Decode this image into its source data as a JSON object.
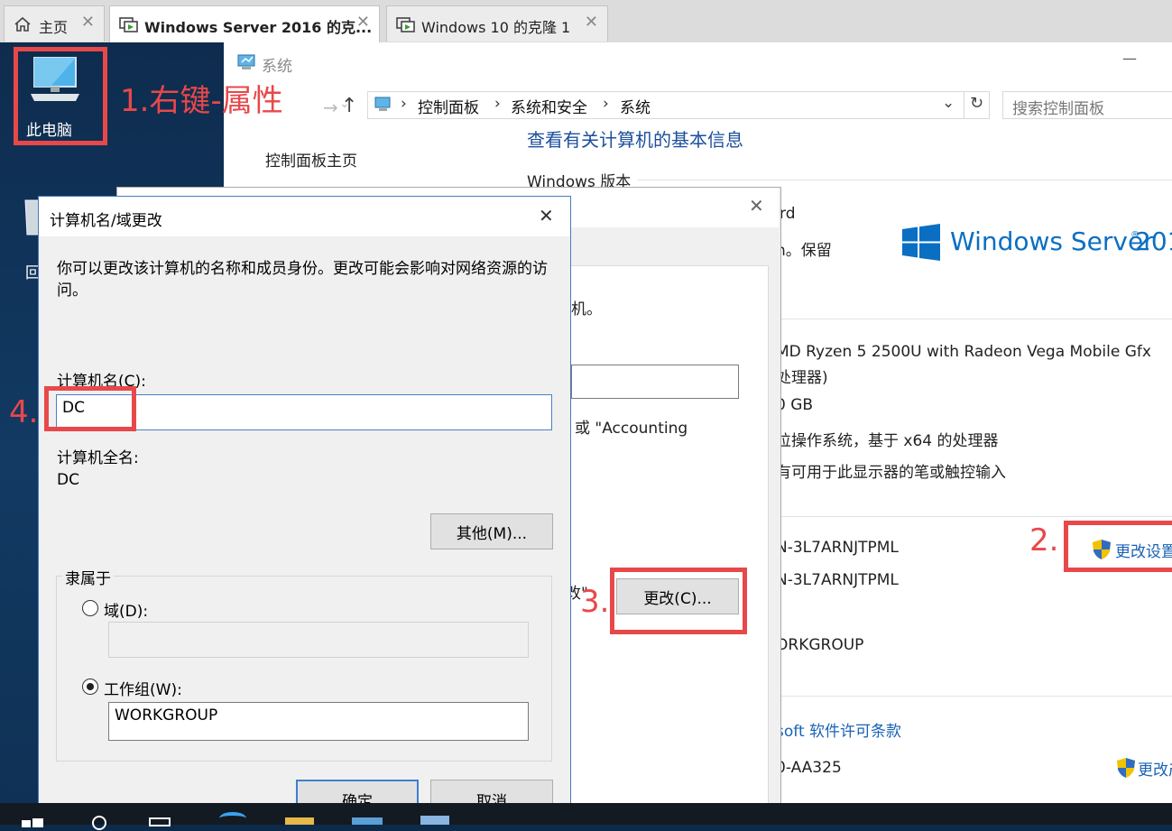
{
  "tabs": [
    {
      "label": "主页",
      "close": "✕"
    },
    {
      "label": "Windows Server 2016 的克...",
      "close": "✕"
    },
    {
      "label": "Windows 10 的克隆 1",
      "close": "✕"
    }
  ],
  "desktop": {
    "this_pc_label": "此电脑",
    "recycle_label": "回"
  },
  "system_window": {
    "title": "系统",
    "minimize": "—",
    "breadcrumb": [
      "控制面板",
      "系统和安全",
      "系统"
    ],
    "search_placeholder": "搜索控制面板",
    "sidebar_home": "控制面板主页",
    "heading": "查看有关计算机的基本信息",
    "windows_version_section": "Windows 版本",
    "edition_fragment": "rd",
    "copyright_fragment": "n。保留",
    "logo_text": "Windows Server",
    "logo_number": "201",
    "processor": "MD Ryzen 5 2500U with Radeon Vega Mobile Gfx",
    "processor_2": "处理器)",
    "memory": "0 GB",
    "system_type": "位操作系统，基于 x64 的处理器",
    "pen_touch": "有可用于此显示器的笔或触控输入",
    "computer_name": "N-3L7ARNJTPML",
    "full_computer_name": "N-3L7ARNJTPML",
    "workgroup": "ORKGROUP",
    "change_settings": "更改设置",
    "license_link": "soft 软件许可条款",
    "product_id": "0-AA325",
    "change_key": "更改产"
  },
  "properties_dialog": {
    "close": "✕",
    "text1": "机。",
    "text2": "或 \"Accounting",
    "text3": "改\"",
    "change_button": "更改(C)..."
  },
  "name_dialog": {
    "title": "计算机名/域更改",
    "close": "✕",
    "description": "你可以更改该计算机的名称和成员身份。更改可能会影响对网络资源的访问。",
    "computer_name_label": "计算机名(C):",
    "computer_name_value": "DC",
    "full_name_label": "计算机全名:",
    "full_name_value": "DC",
    "more_button": "其他(M)...",
    "member_of_label": "隶属于",
    "domain_label": "域(D):",
    "domain_value": "",
    "workgroup_label": "工作组(W):",
    "workgroup_value": "WORKGROUP",
    "ok_button": "确定",
    "cancel_button": "取消"
  },
  "annotations": {
    "step1": "1.右键-属性",
    "step2": "2.",
    "step3": "3.",
    "step4": "4."
  },
  "colors": {
    "annotation_red": "#e8484a",
    "link_blue": "#1a63b5",
    "heading_blue": "#1c4f9c",
    "windows_blue": "#0a6fc2"
  }
}
